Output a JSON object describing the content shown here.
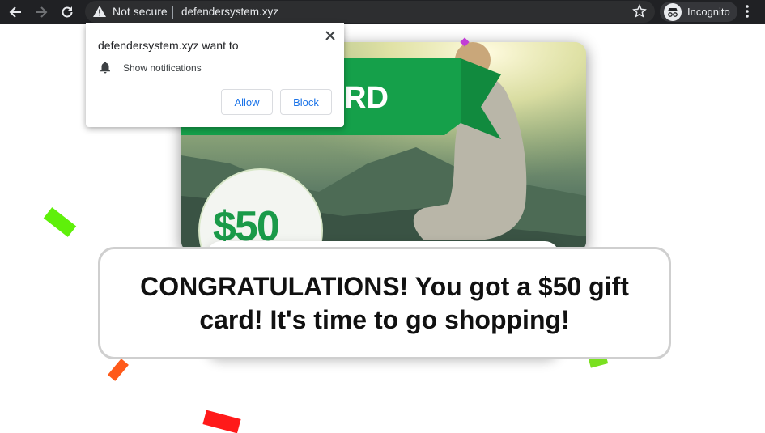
{
  "browser": {
    "security_label": "Not secure",
    "url": "defendersystem.xyz",
    "profile_label": "Incognito",
    "icons": [
      "back-icon",
      "forward-icon",
      "reload-icon",
      "warning-icon",
      "star-icon",
      "incognito-icon",
      "menu-icon"
    ]
  },
  "permission_popup": {
    "title": "defendersystem.xyz want to",
    "permission_text": "Show notifications",
    "allow_label": "Allow",
    "block_label": "Block",
    "icons": [
      "close-icon",
      "bell-icon"
    ]
  },
  "gift_card": {
    "banner_text": "RD",
    "price_text": "$50",
    "colors": {
      "brand_green": "#16a14b",
      "price_green": "#1a9a49"
    }
  },
  "message": {
    "text": "CONGRATULATIONS! You got a $50 gift card! It's time to go shopping!"
  },
  "colors": {
    "toolbar_bg": "#202124",
    "omnibox_bg": "#2d2e30",
    "link_blue": "#1a73e8",
    "confetti": [
      "#5ff00a",
      "#ff5a1a",
      "#ff1a1a",
      "#7ae020",
      "#c23bd6"
    ]
  }
}
